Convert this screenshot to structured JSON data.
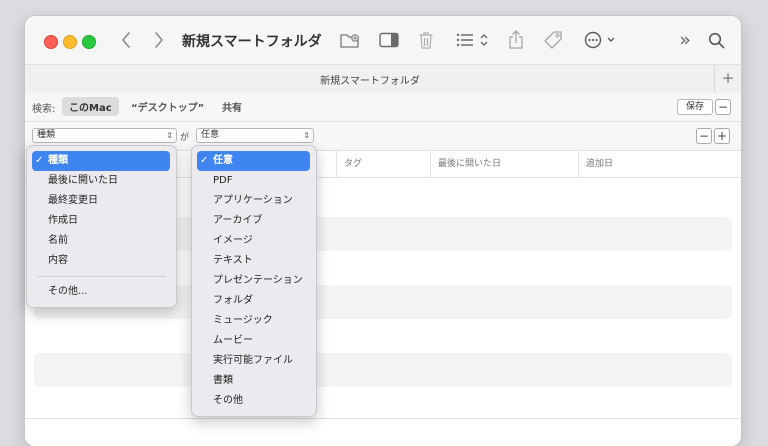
{
  "window": {
    "title": "新規スマートフォルダ"
  },
  "tab": {
    "title": "新規スマートフォルダ",
    "add": "+"
  },
  "search_bar": {
    "label": "検索:",
    "scopes": [
      "このMac",
      "“デスクトップ”",
      "共有"
    ],
    "selected_scope": "このMac",
    "save_label": "保存",
    "remove": "−"
  },
  "criteria": {
    "attribute": "種類",
    "connector": "が",
    "value": "任意",
    "remove": "−",
    "add": "+"
  },
  "columns": [
    "タグ",
    "最後に開いた日",
    "追加日"
  ],
  "attribute_menu": {
    "items": [
      "種類",
      "最後に開いた日",
      "最終変更日",
      "作成日",
      "名前",
      "内容"
    ],
    "selected": "種類",
    "other": "その他..."
  },
  "kind_menu": {
    "items": [
      "任意",
      "PDF",
      "アプリケーション",
      "アーカイブ",
      "イメージ",
      "テキスト",
      "プレゼンテーション",
      "フォルダ",
      "ミュージック",
      "ムービー",
      "実行可能ファイル",
      "書類",
      "その他"
    ],
    "selected": "任意"
  },
  "glyphs": {
    "check": "✓",
    "popup_arrows": "⇕",
    "chevron_left": "‹",
    "chevron_right": "›",
    "more_toolbar": "»"
  }
}
